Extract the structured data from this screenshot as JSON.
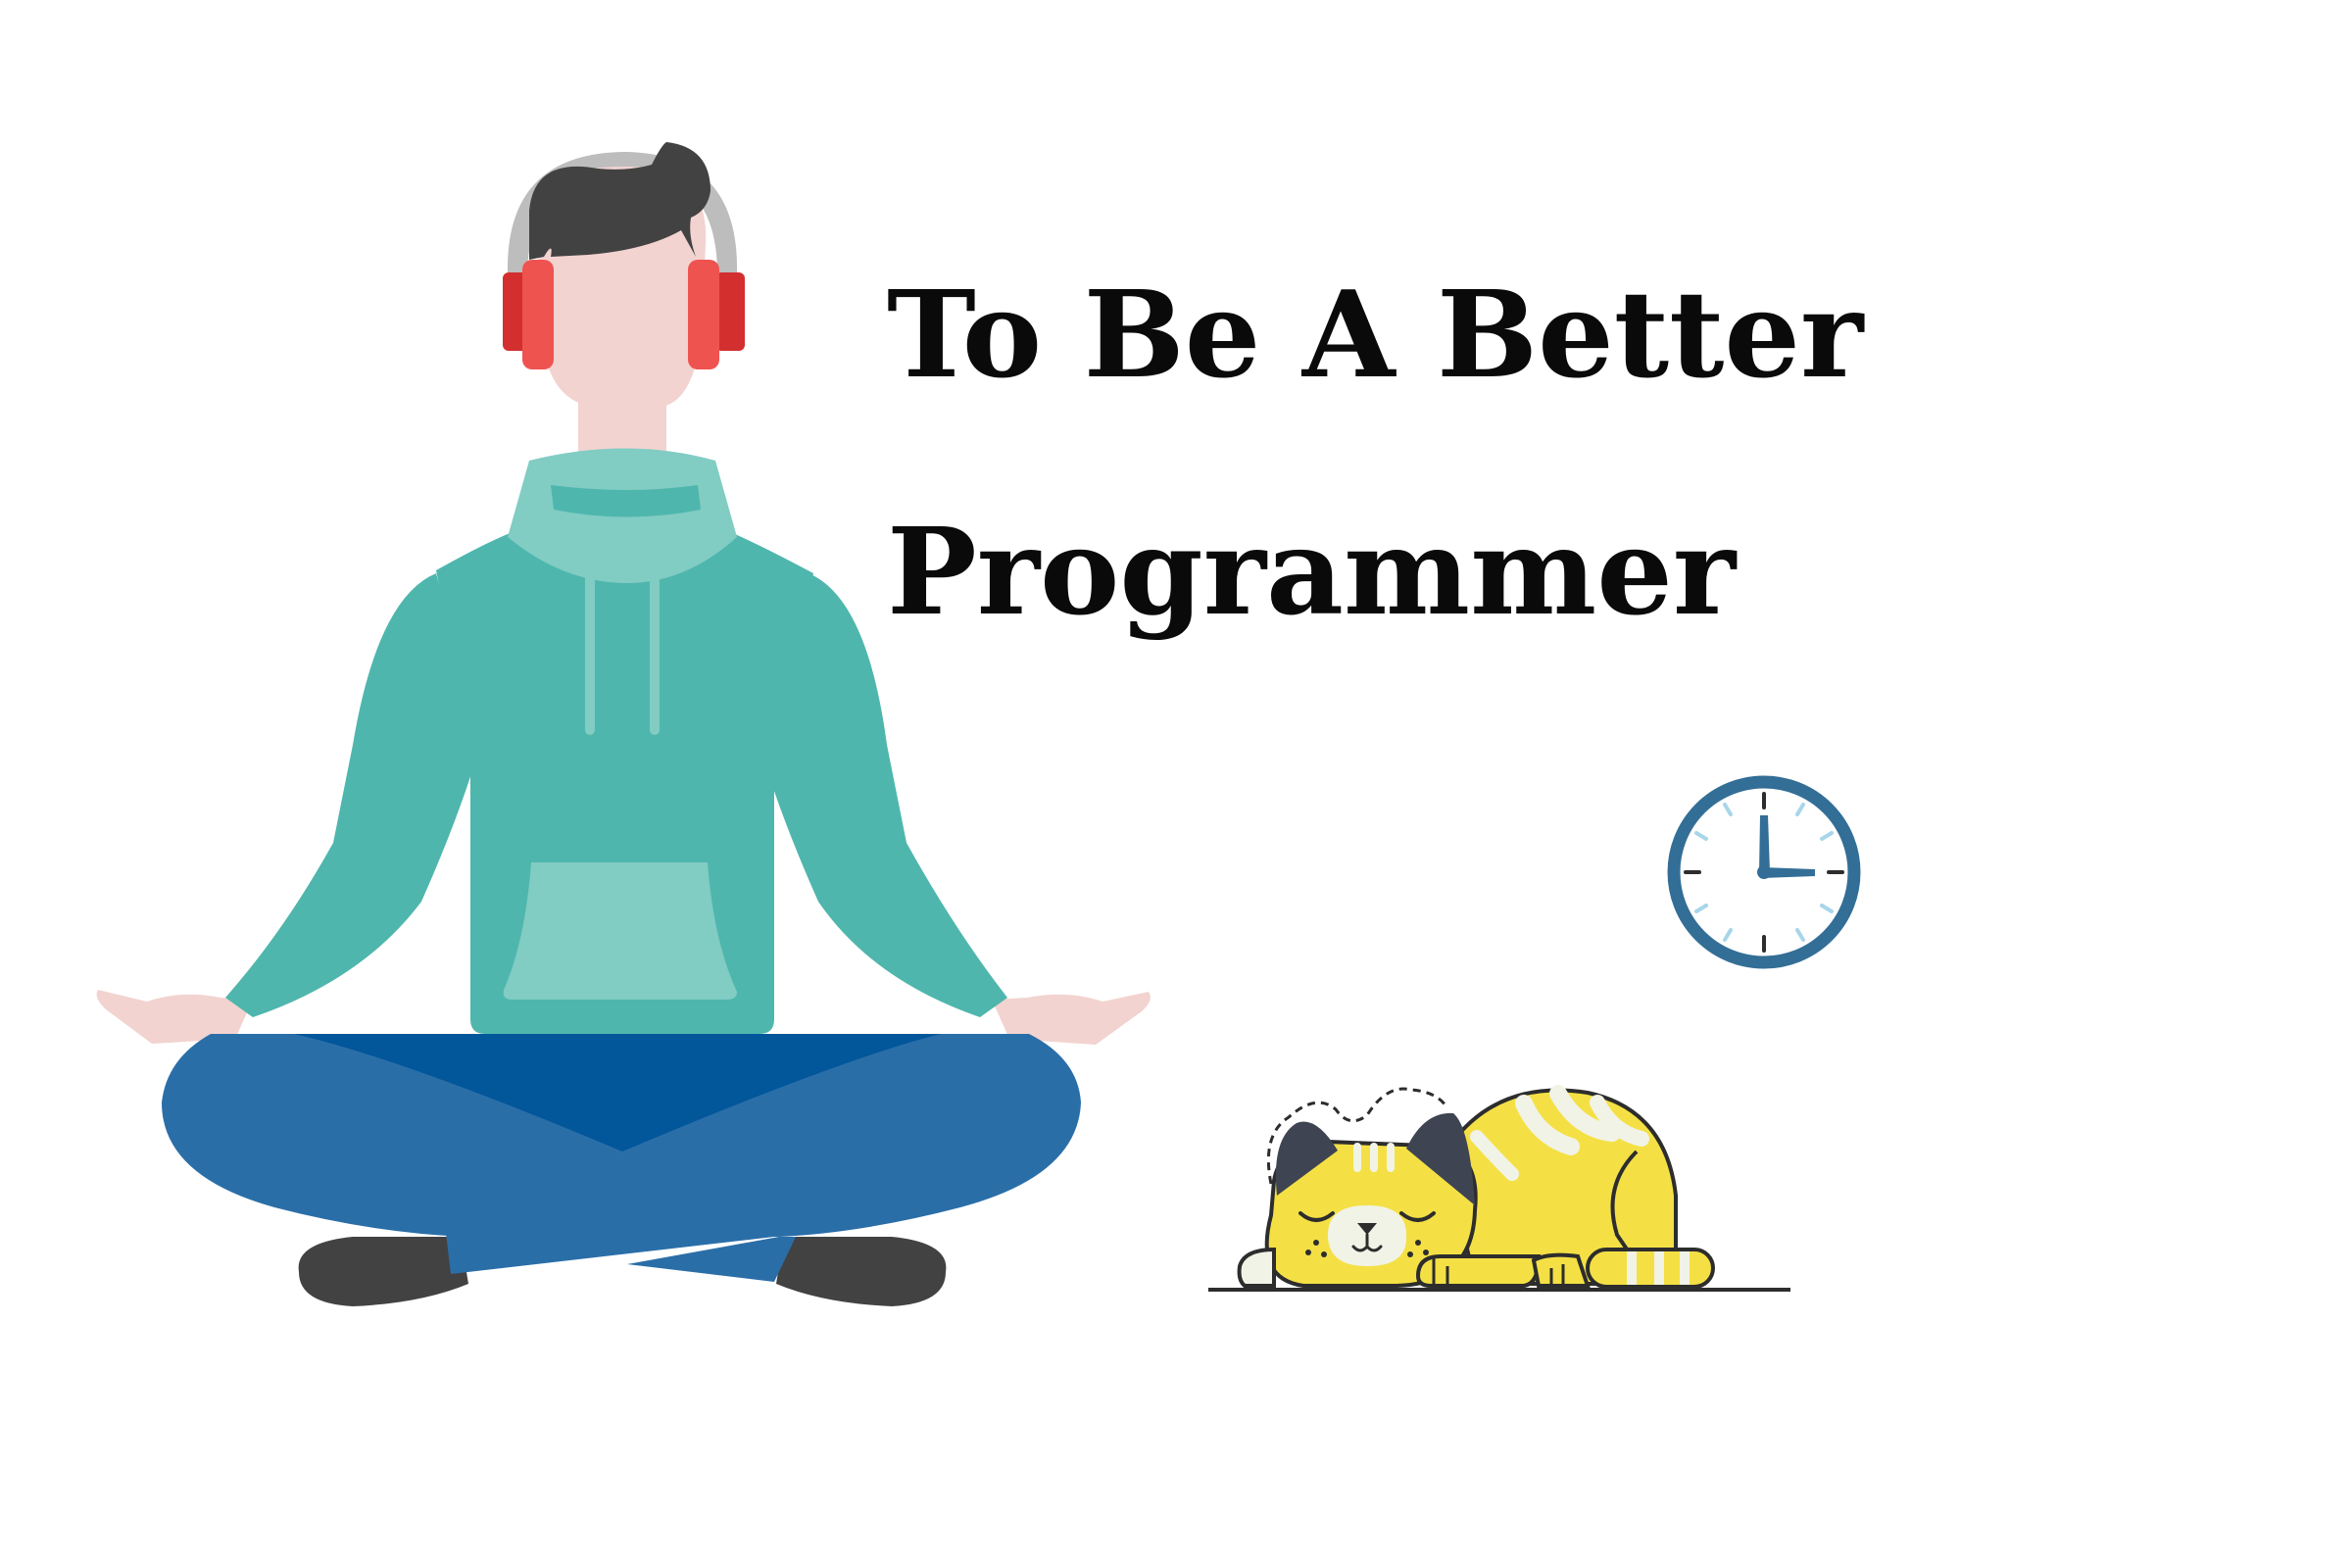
{
  "heading": {
    "line1": "To Be A Better",
    "line2": "Programmer"
  },
  "illustrations": {
    "person": "meditating-programmer-illustration",
    "clock": "clock-icon",
    "cat": "sleeping-cat-illustration"
  },
  "clock": {
    "time": "3:00"
  },
  "colors": {
    "background": "#ffffff",
    "text": "#0a0a0a",
    "hoodie": "#4fb6ad",
    "hoodie_light": "#81ccc3",
    "jeans": "#2a6ea8",
    "jeans_dark": "#02569a",
    "skin": "#f2d3d0",
    "hair": "#424242",
    "headphones": "#ef5350",
    "headphones_dark": "#d32f2f",
    "headphone_band": "#bdbdbd",
    "shoes": "#424242",
    "clock_ring": "#336e96",
    "clock_ticks": "#a8d5ea",
    "cat_body": "#f4e045",
    "cat_stripes": "#f1f3e6",
    "cat_outline": "#2d2d2d",
    "cat_ears": "#3e4452"
  }
}
